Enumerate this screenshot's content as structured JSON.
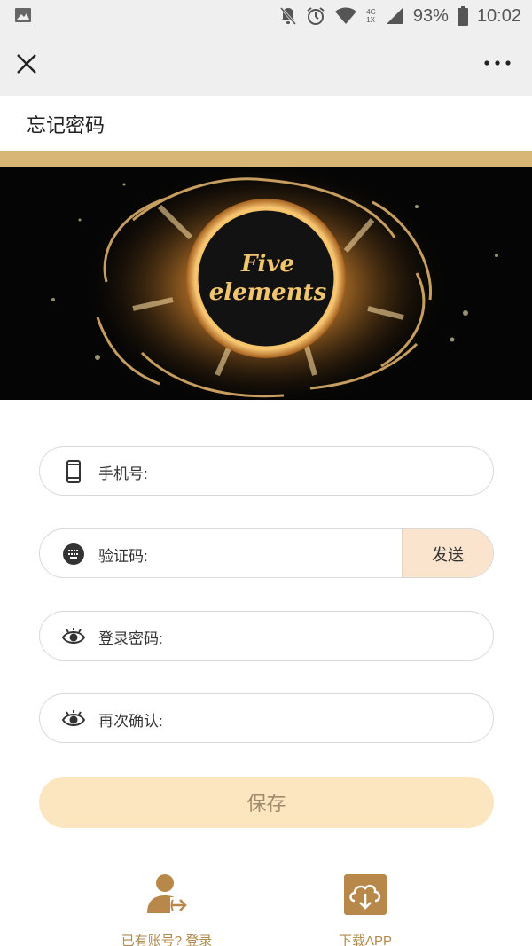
{
  "status_bar": {
    "battery_percent": "93%",
    "time": "10:02",
    "network_badge_top": "4G",
    "network_badge_bottom": "1X"
  },
  "nav": {
    "close_icon": "close-icon",
    "more_icon": "more-dots-icon"
  },
  "page": {
    "title": "忘记密码"
  },
  "banner": {
    "line1": "Five",
    "line2": "elements"
  },
  "form": {
    "phone_label": "手机号:",
    "code_label": "验证码:",
    "send_button": "发送",
    "password_label": "登录密码:",
    "confirm_label": "再次确认:",
    "save_button": "保存"
  },
  "footer": {
    "login_link": "已有账号? 登录",
    "download_link": "下载APP"
  },
  "colors": {
    "gold": "#d8b675",
    "save_bg": "#fbe6c0",
    "send_bg": "#fbe4cd",
    "link_text": "#b08a4a",
    "icon_brown": "#b8884a"
  }
}
